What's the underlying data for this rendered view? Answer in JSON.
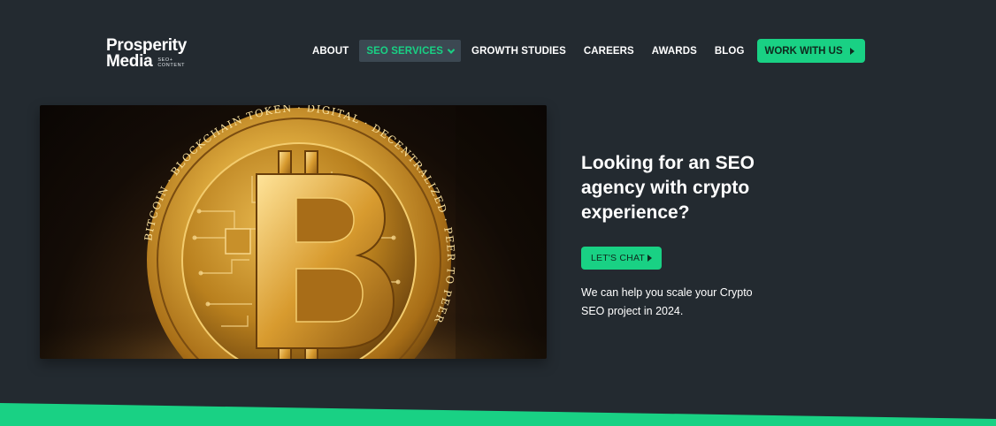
{
  "brand": {
    "line1": "Prosperity",
    "line2": "Media",
    "tagline_1": "SEO+",
    "tagline_2": "CONTENT"
  },
  "nav": {
    "items": [
      {
        "label": "ABOUT"
      },
      {
        "label": "SEO SERVICES",
        "active": true
      },
      {
        "label": "GROWTH STUDIES"
      },
      {
        "label": "CAREERS"
      },
      {
        "label": "AWARDS"
      },
      {
        "label": "BLOG"
      }
    ],
    "cta_label": "WORK WITH US"
  },
  "hero": {
    "headline": "Looking for an SEO agency with crypto experience?",
    "button_label": "LET'S CHAT",
    "body": "We can help you scale your Crypto SEO project in 2024.",
    "image_icon": "bitcoin-coin",
    "coin_text": "BITCOIN · BLOCKCHAIN TOKEN · DIGITAL · DECENTRALIZED · PEER TO PEER"
  },
  "colors": {
    "background": "#232a30",
    "accent": "#19d184",
    "nav_active_bg": "#3c4852"
  }
}
